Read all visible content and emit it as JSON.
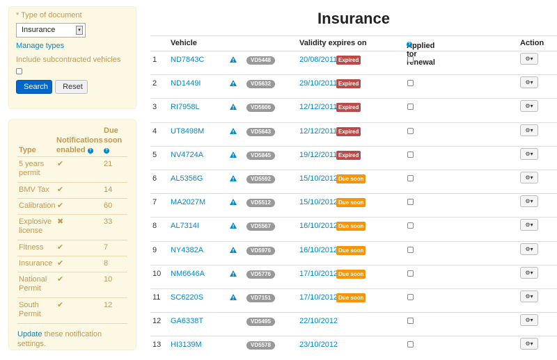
{
  "filter": {
    "type_label": "* Type of document",
    "type_value": "Insurance",
    "manage_types": "Manage types",
    "include_label": "Include subcontracted vehicles",
    "search_btn": "Search",
    "reset_btn": "Reset"
  },
  "notifications": {
    "header_type": "Type",
    "header_notif_1": "Notifications",
    "header_notif_2": "enabled",
    "header_due_1": "Due",
    "header_due_2": "soon",
    "rows": [
      {
        "type": "5 years permit",
        "enabled": true,
        "due": "21"
      },
      {
        "type": "BMV Tax",
        "enabled": true,
        "due": "14"
      },
      {
        "type": "Calibration",
        "enabled": true,
        "due": "60"
      },
      {
        "type": "Explosive license",
        "enabled": false,
        "due": "33"
      },
      {
        "type": "Fitness",
        "enabled": true,
        "due": "7"
      },
      {
        "type": "Insurance",
        "enabled": true,
        "due": "8"
      },
      {
        "type": "National Permit",
        "enabled": true,
        "due": "10"
      },
      {
        "type": "South Permit",
        "enabled": true,
        "due": "12"
      }
    ],
    "footer_link": "Update",
    "footer_text": " these notification settings."
  },
  "page": {
    "title": "Insurance"
  },
  "table": {
    "headers": {
      "vehicle": "Vehicle",
      "validity": "Validity expires on",
      "renewal": "Applied for renewal",
      "action": "Action"
    },
    "rows": [
      {
        "idx": "1",
        "vehicle": "ND7843C",
        "warn": true,
        "vd": "VD5448",
        "date": "20/08/2011",
        "status": "Expired"
      },
      {
        "idx": "2",
        "vehicle": "ND1449I",
        "warn": true,
        "vd": "VD5632",
        "date": "29/10/2011",
        "status": "Expired"
      },
      {
        "idx": "3",
        "vehicle": "RI7958L",
        "warn": true,
        "vd": "VD5606",
        "date": "12/12/2011",
        "status": "Expired"
      },
      {
        "idx": "4",
        "vehicle": "UT8498M",
        "warn": true,
        "vd": "VD5643",
        "date": "12/12/2011",
        "status": "Expired"
      },
      {
        "idx": "5",
        "vehicle": "NV4724A",
        "warn": true,
        "vd": "VD5845",
        "date": "19/12/2011",
        "status": "Expired"
      },
      {
        "idx": "6",
        "vehicle": "AL5356G",
        "warn": true,
        "vd": "VD5592",
        "date": "15/10/2012",
        "status": "Due soon"
      },
      {
        "idx": "7",
        "vehicle": "MA2027M",
        "warn": true,
        "vd": "VD5512",
        "date": "15/10/2012",
        "status": "Due soon"
      },
      {
        "idx": "8",
        "vehicle": "AL7314I",
        "warn": true,
        "vd": "VD5567",
        "date": "16/10/2012",
        "status": "Due soon"
      },
      {
        "idx": "9",
        "vehicle": "NY4382A",
        "warn": true,
        "vd": "VD5976",
        "date": "16/10/2012",
        "status": "Due soon"
      },
      {
        "idx": "10",
        "vehicle": "NM6646A",
        "warn": true,
        "vd": "VD5776",
        "date": "17/10/2012",
        "status": "Due soon"
      },
      {
        "idx": "11",
        "vehicle": "SC6220S",
        "warn": true,
        "vd": "VD7151",
        "date": "17/10/2012",
        "status": "Due soon"
      },
      {
        "idx": "12",
        "vehicle": "GA6338T",
        "warn": false,
        "vd": "VD5495",
        "date": "22/10/2012",
        "status": ""
      },
      {
        "idx": "13",
        "vehicle": "HI3139M",
        "warn": false,
        "vd": "VD5578",
        "date": "23/10/2012",
        "status": ""
      }
    ]
  },
  "colors": {
    "link": "#0088cc",
    "expired": "#b94a48",
    "due_soon": "#f89406",
    "panel_bg": "#fcf8e3",
    "primary_button": "#0066cc"
  }
}
